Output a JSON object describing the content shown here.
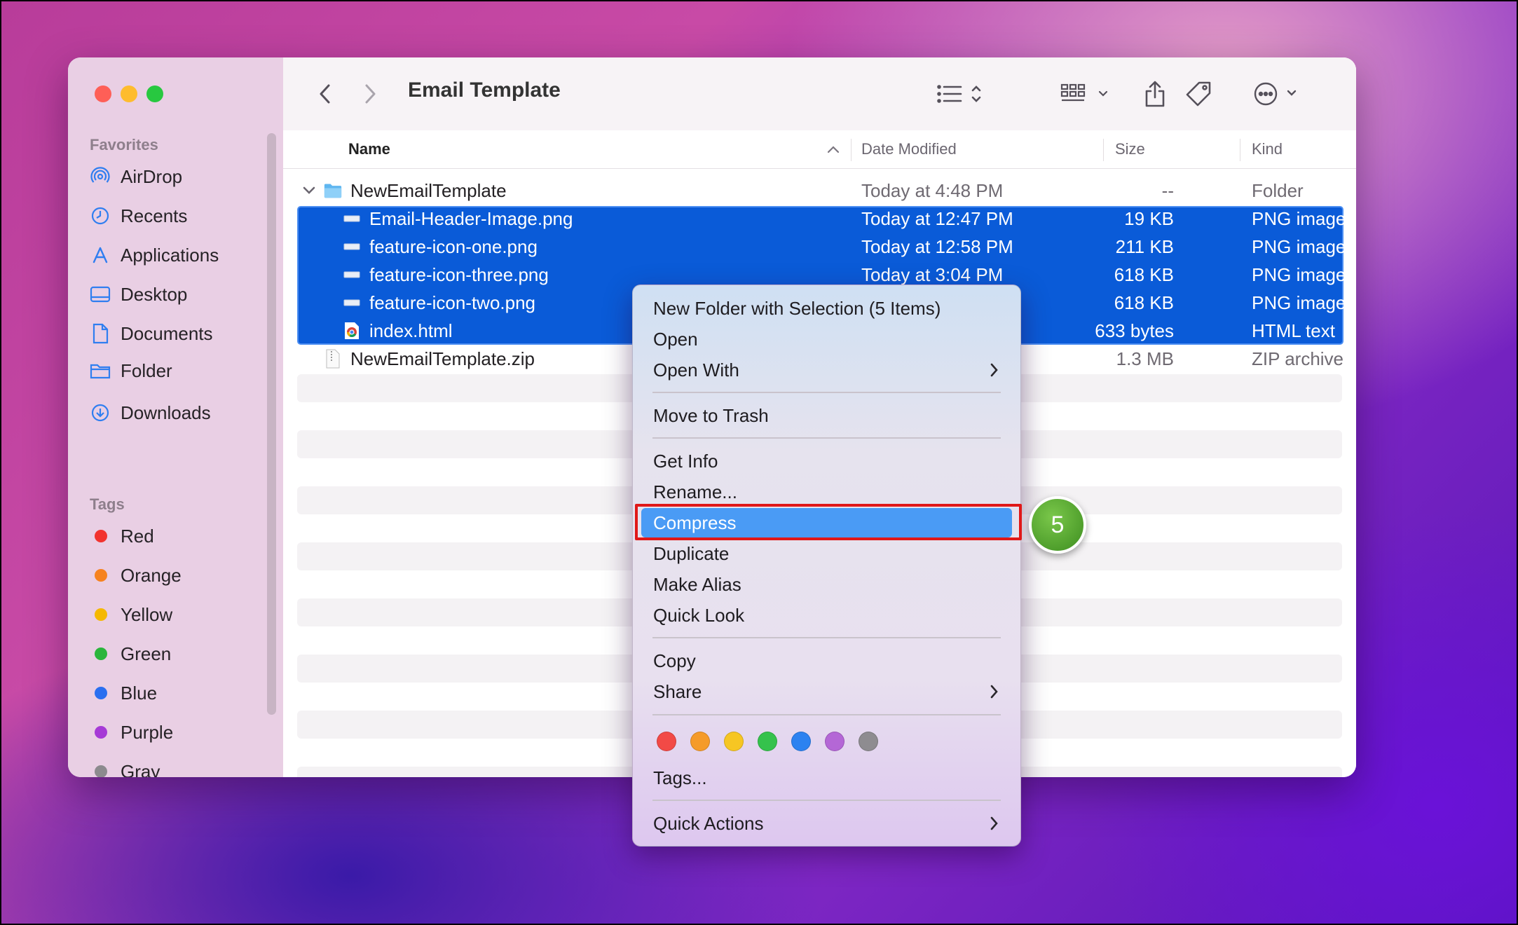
{
  "window": {
    "title": "Email Template"
  },
  "sidebar": {
    "favorites_header": "Favorites",
    "favorites": [
      {
        "label": "AirDrop",
        "icon": "airdrop-icon"
      },
      {
        "label": "Recents",
        "icon": "clock-icon"
      },
      {
        "label": "Applications",
        "icon": "applications-icon"
      },
      {
        "label": "Desktop",
        "icon": "desktop-icon"
      },
      {
        "label": "Documents",
        "icon": "document-icon"
      },
      {
        "label": "Folder",
        "icon": "folder-icon"
      },
      {
        "label": "Downloads",
        "icon": "download-icon"
      }
    ],
    "tags_header": "Tags",
    "tags": [
      {
        "label": "Red",
        "color": "#f2332e"
      },
      {
        "label": "Orange",
        "color": "#f6821f"
      },
      {
        "label": "Yellow",
        "color": "#f5b800"
      },
      {
        "label": "Green",
        "color": "#2bb53c"
      },
      {
        "label": "Blue",
        "color": "#2a6ff0"
      },
      {
        "label": "Purple",
        "color": "#a63ad6"
      },
      {
        "label": "Gray",
        "color": "#8c8a8e"
      }
    ]
  },
  "columns": {
    "name": "Name",
    "date": "Date Modified",
    "size": "Size",
    "kind": "Kind"
  },
  "files": [
    {
      "name": "NewEmailTemplate",
      "date": "Today at 4:48 PM",
      "size": "--",
      "kind": "Folder",
      "icon": "folder-icon",
      "selected": false
    },
    {
      "name": "Email-Header-Image.png",
      "date": "Today at 12:47 PM",
      "size": "19 KB",
      "kind": "PNG image",
      "icon": "image-file-icon",
      "selected": true
    },
    {
      "name": "feature-icon-one.png",
      "date": "Today at 12:58 PM",
      "size": "211 KB",
      "kind": "PNG image",
      "icon": "image-file-icon",
      "selected": true
    },
    {
      "name": "feature-icon-three.png",
      "date": "Today at 3:04 PM",
      "size": "618 KB",
      "kind": "PNG image",
      "icon": "image-file-icon",
      "selected": true
    },
    {
      "name": "feature-icon-two.png",
      "date": "",
      "size": "618 KB",
      "kind": "PNG image",
      "icon": "image-file-icon",
      "selected": true
    },
    {
      "name": "index.html",
      "date": "",
      "size": "633 bytes",
      "kind": "HTML text",
      "icon": "chrome-html-icon",
      "selected": true
    },
    {
      "name": "NewEmailTemplate.zip",
      "date": "",
      "size": "1.3 MB",
      "kind": "ZIP archive",
      "icon": "zip-file-icon",
      "selected": false
    }
  ],
  "context_menu": {
    "items": {
      "new_folder": "New Folder with Selection (5 Items)",
      "open": "Open",
      "open_with": "Open With",
      "move_to_trash": "Move to Trash",
      "get_info": "Get Info",
      "rename": "Rename...",
      "compress": "Compress",
      "duplicate": "Duplicate",
      "make_alias": "Make Alias",
      "quick_look": "Quick Look",
      "copy": "Copy",
      "share": "Share",
      "tags": "Tags...",
      "quick_actions": "Quick Actions"
    },
    "tag_colors": [
      "#f24a46",
      "#f59b2a",
      "#f6c623",
      "#35c24c",
      "#2c82f0",
      "#b467d6",
      "#8e8c90"
    ]
  },
  "step_badge": "5"
}
